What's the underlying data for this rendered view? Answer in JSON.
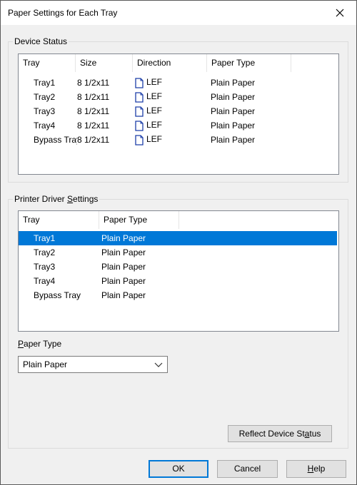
{
  "window": {
    "title": "Paper Settings for Each Tray"
  },
  "device_status": {
    "label": "Device Status",
    "columns": [
      "Tray",
      "Size",
      "Direction",
      "Paper Type"
    ],
    "rows": [
      {
        "tray": "Tray1",
        "size": "8 1/2x11",
        "direction": "LEF",
        "paper_type": "Plain Paper"
      },
      {
        "tray": "Tray2",
        "size": "8 1/2x11",
        "direction": "LEF",
        "paper_type": "Plain Paper"
      },
      {
        "tray": "Tray3",
        "size": "8 1/2x11",
        "direction": "LEF",
        "paper_type": "Plain Paper"
      },
      {
        "tray": "Tray4",
        "size": "8 1/2x11",
        "direction": "LEF",
        "paper_type": "Plain Paper"
      },
      {
        "tray": "Bypass Tray",
        "size": "8 1/2x11",
        "direction": "LEF",
        "paper_type": "Plain Paper"
      }
    ]
  },
  "driver_settings": {
    "label_pre": "Printer Driver ",
    "label_u": "S",
    "label_post": "ettings",
    "columns": [
      "Tray",
      "Paper Type"
    ],
    "rows": [
      {
        "tray": "Tray1",
        "paper_type": "Plain Paper"
      },
      {
        "tray": "Tray2",
        "paper_type": "Plain Paper"
      },
      {
        "tray": "Tray3",
        "paper_type": "Plain Paper"
      },
      {
        "tray": "Tray4",
        "paper_type": "Plain Paper"
      },
      {
        "tray": "Bypass Tray",
        "paper_type": "Plain Paper"
      }
    ],
    "selected_index": 0,
    "paper_type_label_u": "P",
    "paper_type_label_post": "aper Type",
    "paper_type_value": "Plain Paper",
    "reflect_pre": "Reflect Device St",
    "reflect_u": "a",
    "reflect_post": "tus"
  },
  "buttons": {
    "ok": "OK",
    "cancel": "Cancel",
    "help_u": "H",
    "help_post": "elp"
  },
  "colors": {
    "selection": "#0078d7",
    "default_button_border": "#0078d7"
  }
}
